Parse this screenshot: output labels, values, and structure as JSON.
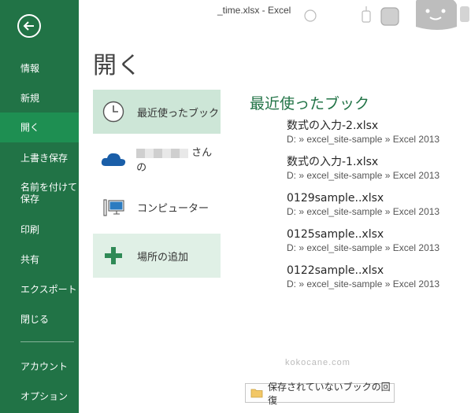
{
  "window": {
    "title": "_time.xlsx - Excel"
  },
  "sidebar": {
    "items": [
      {
        "label": "情報"
      },
      {
        "label": "新規"
      },
      {
        "label": "開く"
      },
      {
        "label": "上書き保存"
      },
      {
        "label": "名前を付けて\n保存"
      },
      {
        "label": "印刷"
      },
      {
        "label": "共有"
      },
      {
        "label": "エクスポート"
      },
      {
        "label": "閉じる"
      },
      {
        "label": "アカウント"
      },
      {
        "label": "オプション"
      }
    ],
    "selected": "開く"
  },
  "main": {
    "title": "開く",
    "places": [
      {
        "label": "最近使ったブック",
        "icon": "clock-icon"
      },
      {
        "label": "さんの",
        "icon": "onedrive-cloud-icon"
      },
      {
        "label": "コンピューター",
        "icon": "computer-icon"
      },
      {
        "label": "場所の追加",
        "icon": "plus-icon"
      }
    ],
    "recent": {
      "title": "最近使ったブック",
      "items": [
        {
          "name": "数式の入力-2.xlsx",
          "path": "D: » excel_site-sample » Excel 2013"
        },
        {
          "name": "数式の入力-1.xlsx",
          "path": "D: » excel_site-sample » Excel 2013"
        },
        {
          "name": "0129sample..xlsx",
          "path": "D: » excel_site-sample » Excel 2013"
        },
        {
          "name": "0125sample..xlsx",
          "path": "D: » excel_site-sample » Excel 2013"
        },
        {
          "name": "0122sample..xlsx",
          "path": "D: » excel_site-sample » Excel 2013"
        }
      ]
    },
    "watermark": "kokocane.com",
    "recover_button": "保存されていないブックの回復"
  },
  "colors": {
    "accent": "#217346",
    "selected_place": "#cde6d7",
    "hover_place": "#e0f0e6"
  }
}
